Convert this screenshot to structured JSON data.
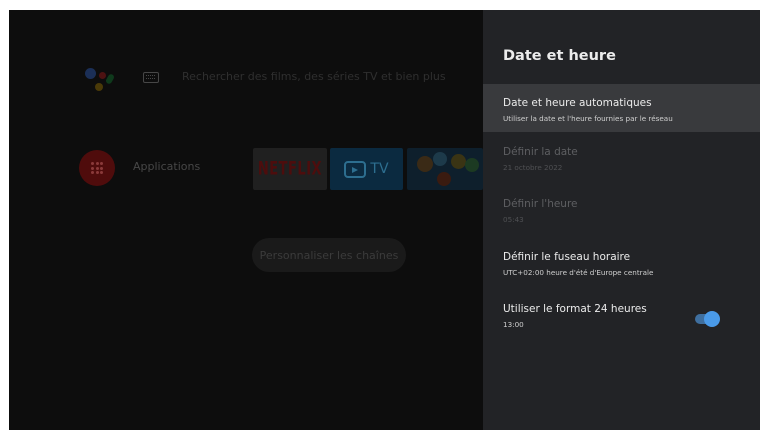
{
  "home": {
    "search_hint": "Rechercher des films, des séries TV et bien plus",
    "apps_label": "Applications",
    "netflix_label": "NETFLIX",
    "tv_label": "TV",
    "customize_label": "Personnaliser les chaînes",
    "icons": [
      "google-assistant-icon",
      "keyboard-icon",
      "apps-grid-icon",
      "netflix-logo",
      "live-tv-icon",
      "kids-app-icon"
    ]
  },
  "panel": {
    "title": "Date et heure",
    "rows": [
      {
        "title": "Date et heure automatiques",
        "subtitle": "Utiliser la date et l'heure fournies par le réseau",
        "state": "focused"
      },
      {
        "title": "Définir la date",
        "subtitle": "21 octobre 2022",
        "state": "disabled"
      },
      {
        "title": "Définir l'heure",
        "subtitle": "05:43",
        "state": "disabled"
      },
      {
        "title": "Définir le fuseau horaire",
        "subtitle": "UTC+02:00 heure d'été d'Europe centrale",
        "state": "enabled"
      },
      {
        "title": "Utiliser le format 24 heures",
        "subtitle": "13:00",
        "state": "enabled",
        "toggle_on": true
      }
    ]
  },
  "colors": {
    "panel_bg": "#222326",
    "focused_row": "#393a3d",
    "toggle_accent": "#4a9ae8",
    "screen_bg": "#0b0b0b"
  }
}
